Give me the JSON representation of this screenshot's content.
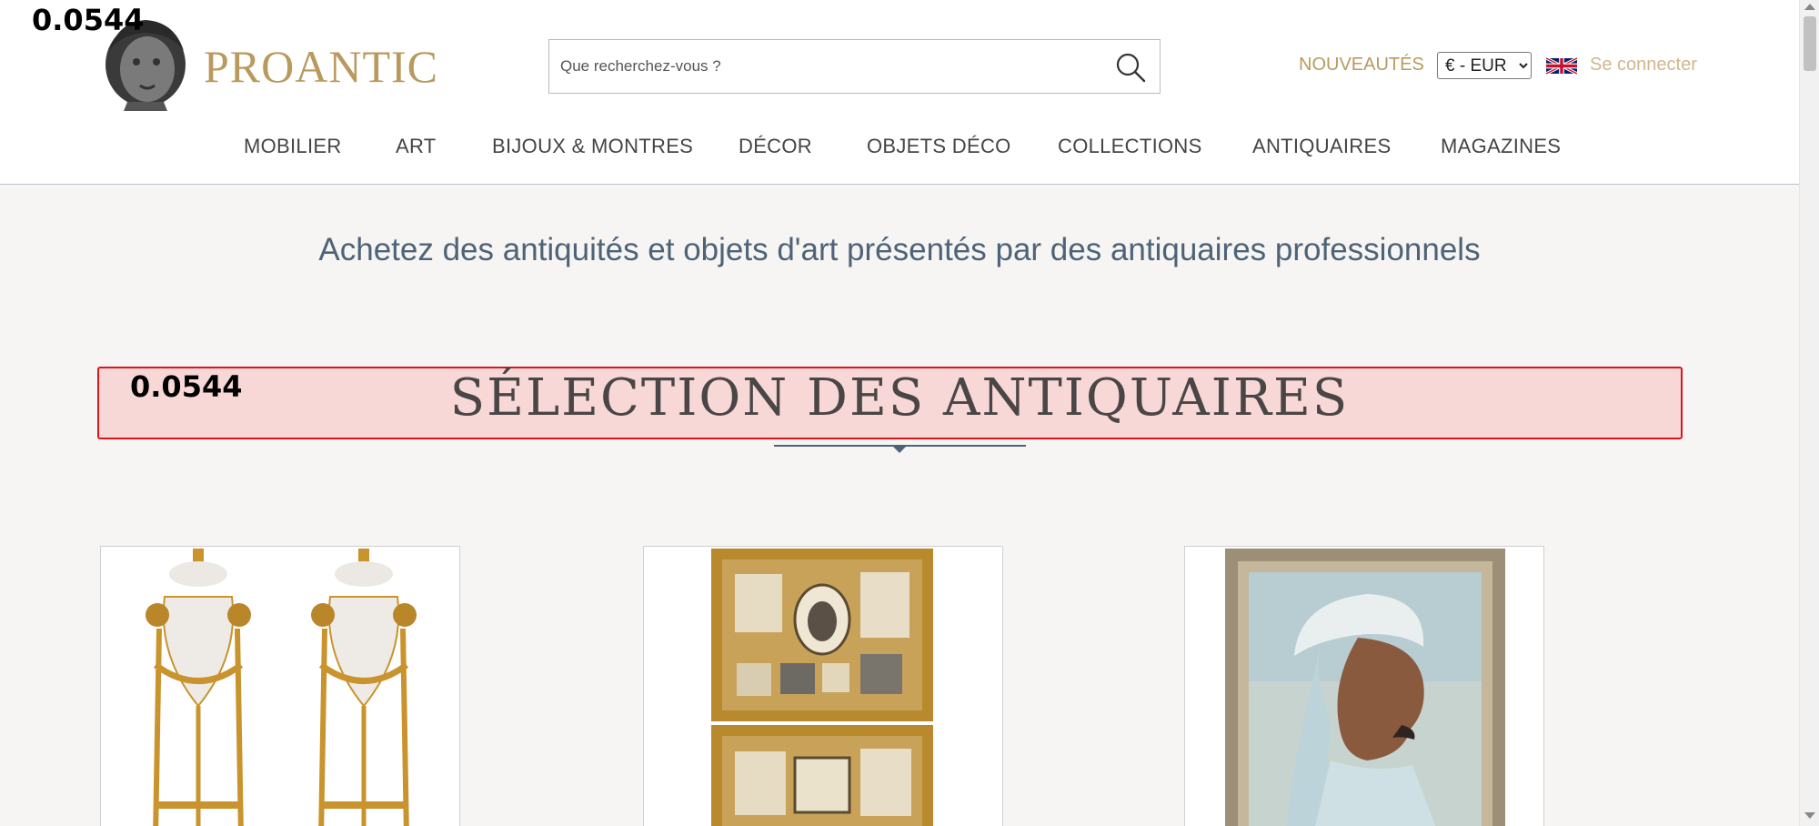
{
  "overlay": {
    "top_value": "0.0544",
    "section_value": "0.0544"
  },
  "header": {
    "logo_icon": "bust-icon",
    "brand": "PROANTIC",
    "search": {
      "placeholder": "Que recherchez-vous ?",
      "icon": "search-icon"
    },
    "new_label": "NOUVEAUTÉS",
    "currency": {
      "selected": "€ - EUR"
    },
    "language_flag": "uk-flag-icon",
    "login_label": "Se connecter"
  },
  "nav": {
    "items": [
      {
        "label": "MOBILIER"
      },
      {
        "label": "ART"
      },
      {
        "label": "BIJOUX & MONTRES"
      },
      {
        "label": "DÉCOR"
      },
      {
        "label": "OBJETS DÉCO"
      },
      {
        "label": "COLLECTIONS"
      },
      {
        "label": "ANTIQUAIRES"
      },
      {
        "label": "MAGAZINES"
      }
    ]
  },
  "main": {
    "tagline": "Achetez des antiquités et objets d'art présentés par des antiquaires professionnels",
    "section_title": "SÉLECTION DES ANTIQUAIRES",
    "products": [
      {
        "image": "alabaster-ormolu-vases-pair-image"
      },
      {
        "image": "framed-trompe-loeil-engravings-image"
      },
      {
        "image": "turbaned-man-portrait-painting-image"
      }
    ]
  },
  "colors": {
    "brand_gold": "#b99a5e",
    "tagline_blue": "#4f6378",
    "highlight_red": "#d9161c",
    "highlight_fill": "#f8d7d7"
  }
}
